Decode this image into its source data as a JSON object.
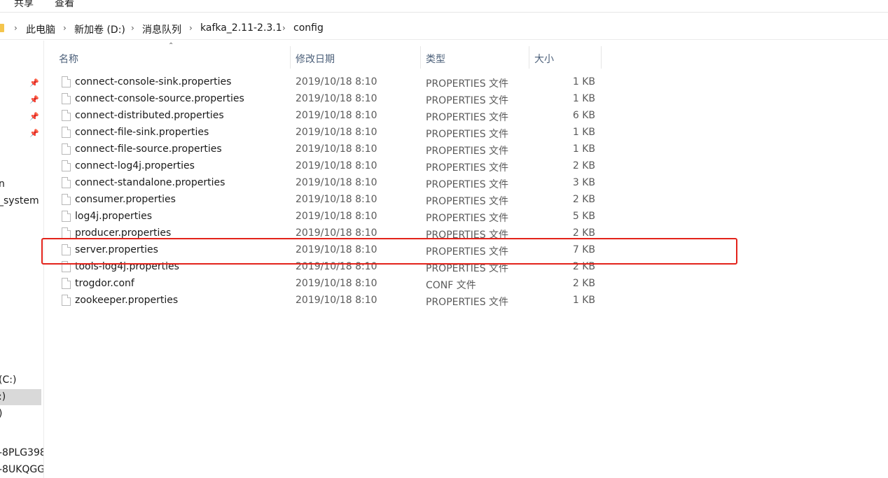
{
  "ribbon": {
    "tabs": [
      "共享",
      "查看"
    ]
  },
  "address": {
    "crumbs": [
      "此电脑",
      "新加卷 (D:)",
      "消息队列",
      "kafka_2.11-2.3.1",
      "config"
    ]
  },
  "nav": {
    "items": [
      "n",
      "_system",
      "(C:)",
      ":)",
      ")",
      "-8PLG398",
      "-8UKQGG"
    ]
  },
  "columns": {
    "name": "名称",
    "date": "修改日期",
    "type": "类型",
    "size": "大小"
  },
  "files": [
    {
      "name": "connect-console-sink.properties",
      "date": "2019/10/18 8:10",
      "type": "PROPERTIES 文件",
      "size": "1 KB"
    },
    {
      "name": "connect-console-source.properties",
      "date": "2019/10/18 8:10",
      "type": "PROPERTIES 文件",
      "size": "1 KB"
    },
    {
      "name": "connect-distributed.properties",
      "date": "2019/10/18 8:10",
      "type": "PROPERTIES 文件",
      "size": "6 KB"
    },
    {
      "name": "connect-file-sink.properties",
      "date": "2019/10/18 8:10",
      "type": "PROPERTIES 文件",
      "size": "1 KB"
    },
    {
      "name": "connect-file-source.properties",
      "date": "2019/10/18 8:10",
      "type": "PROPERTIES 文件",
      "size": "1 KB"
    },
    {
      "name": "connect-log4j.properties",
      "date": "2019/10/18 8:10",
      "type": "PROPERTIES 文件",
      "size": "2 KB"
    },
    {
      "name": "connect-standalone.properties",
      "date": "2019/10/18 8:10",
      "type": "PROPERTIES 文件",
      "size": "3 KB"
    },
    {
      "name": "consumer.properties",
      "date": "2019/10/18 8:10",
      "type": "PROPERTIES 文件",
      "size": "2 KB"
    },
    {
      "name": "log4j.properties",
      "date": "2019/10/18 8:10",
      "type": "PROPERTIES 文件",
      "size": "5 KB"
    },
    {
      "name": "producer.properties",
      "date": "2019/10/18 8:10",
      "type": "PROPERTIES 文件",
      "size": "2 KB"
    },
    {
      "name": "server.properties",
      "date": "2019/10/18 8:10",
      "type": "PROPERTIES 文件",
      "size": "7 KB"
    },
    {
      "name": "tools-log4j.properties",
      "date": "2019/10/18 8:10",
      "type": "PROPERTIES 文件",
      "size": "2 KB"
    },
    {
      "name": "trogdor.conf",
      "date": "2019/10/18 8:10",
      "type": "CONF 文件",
      "size": "2 KB"
    },
    {
      "name": "zookeeper.properties",
      "date": "2019/10/18 8:10",
      "type": "PROPERTIES 文件",
      "size": "1 KB"
    }
  ],
  "highlight_color": "#e3231b"
}
